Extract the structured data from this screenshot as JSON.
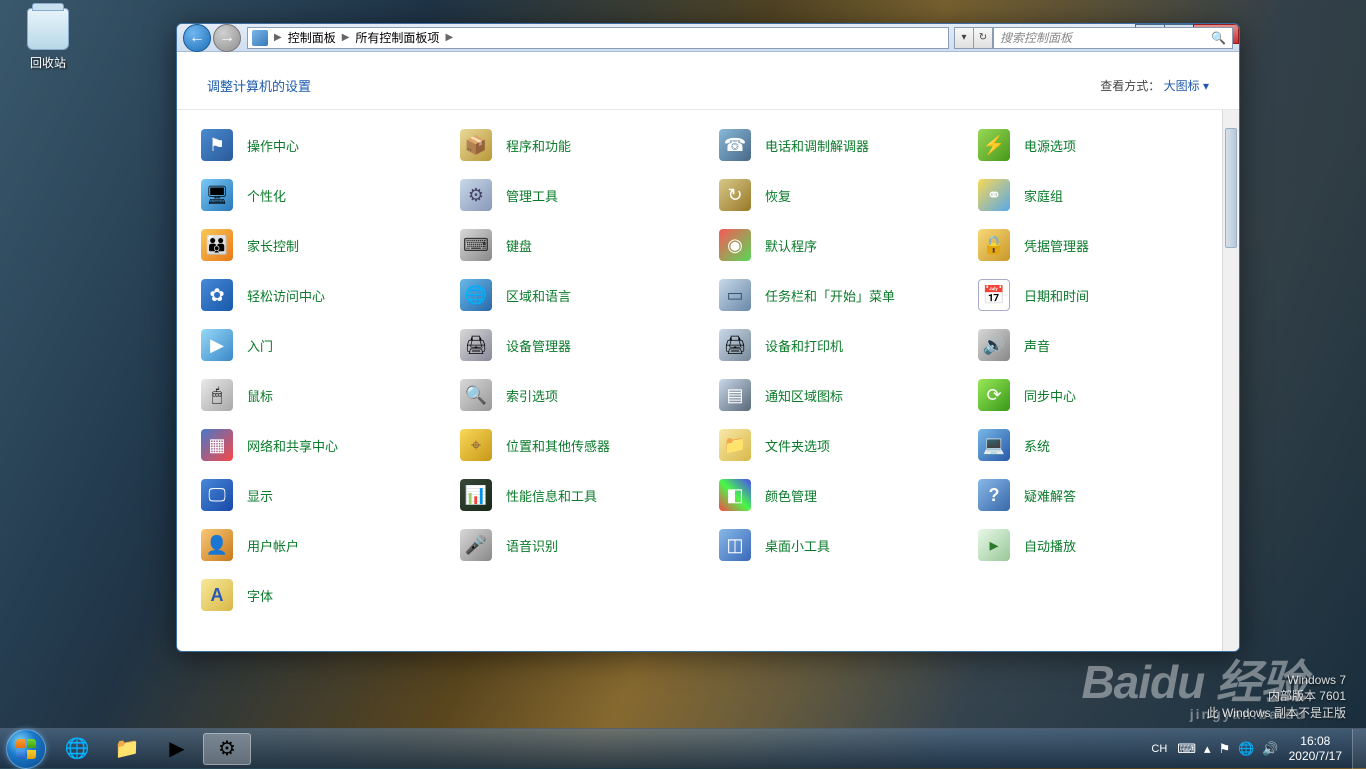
{
  "desktop": {
    "recycle_bin": "回收站"
  },
  "window": {
    "breadcrumb": {
      "root": "控制面板",
      "current": "所有控制面板项"
    },
    "search_placeholder": "搜索控制面板",
    "heading": "调整计算机的设置",
    "view_label": "查看方式：",
    "view_value": "大图标",
    "items": [
      {
        "label": "操作中心",
        "icon": "ic-flag"
      },
      {
        "label": "程序和功能",
        "icon": "ic-prog"
      },
      {
        "label": "电话和调制解调器",
        "icon": "ic-phone"
      },
      {
        "label": "电源选项",
        "icon": "ic-power"
      },
      {
        "label": "个性化",
        "icon": "ic-pers"
      },
      {
        "label": "管理工具",
        "icon": "ic-admin"
      },
      {
        "label": "恢复",
        "icon": "ic-recov"
      },
      {
        "label": "家庭组",
        "icon": "ic-home"
      },
      {
        "label": "家长控制",
        "icon": "ic-parent"
      },
      {
        "label": "键盘",
        "icon": "ic-kbd"
      },
      {
        "label": "默认程序",
        "icon": "ic-default"
      },
      {
        "label": "凭据管理器",
        "icon": "ic-cred"
      },
      {
        "label": "轻松访问中心",
        "icon": "ic-ease"
      },
      {
        "label": "区域和语言",
        "icon": "ic-region"
      },
      {
        "label": "任务栏和「开始」菜单",
        "icon": "ic-taskbar"
      },
      {
        "label": "日期和时间",
        "icon": "ic-date"
      },
      {
        "label": "入门",
        "icon": "ic-start"
      },
      {
        "label": "设备管理器",
        "icon": "ic-devmgr"
      },
      {
        "label": "设备和打印机",
        "icon": "ic-devprn"
      },
      {
        "label": "声音",
        "icon": "ic-sound"
      },
      {
        "label": "鼠标",
        "icon": "ic-mouse"
      },
      {
        "label": "索引选项",
        "icon": "ic-index"
      },
      {
        "label": "通知区域图标",
        "icon": "ic-notif"
      },
      {
        "label": "同步中心",
        "icon": "ic-sync"
      },
      {
        "label": "网络和共享中心",
        "icon": "ic-net"
      },
      {
        "label": "位置和其他传感器",
        "icon": "ic-loc"
      },
      {
        "label": "文件夹选项",
        "icon": "ic-folder"
      },
      {
        "label": "系统",
        "icon": "ic-sys"
      },
      {
        "label": "显示",
        "icon": "ic-disp"
      },
      {
        "label": "性能信息和工具",
        "icon": "ic-perf"
      },
      {
        "label": "颜色管理",
        "icon": "ic-color"
      },
      {
        "label": "疑难解答",
        "icon": "ic-trouble"
      },
      {
        "label": "用户帐户",
        "icon": "ic-user"
      },
      {
        "label": "语音识别",
        "icon": "ic-speech"
      },
      {
        "label": "桌面小工具",
        "icon": "ic-gadget"
      },
      {
        "label": "自动播放",
        "icon": "ic-auto"
      },
      {
        "label": "字体",
        "icon": "ic-font"
      }
    ]
  },
  "taskbar": {
    "time": "16:08",
    "date": "2020/7/17",
    "ime": "CH"
  },
  "watermark": {
    "line1": "Windows 7",
    "line2": "内部版本 7601",
    "line3": "此 Windows 副本不是正版",
    "brand": "Baidu 经验",
    "brand_sub": "jingyan.baidu"
  }
}
